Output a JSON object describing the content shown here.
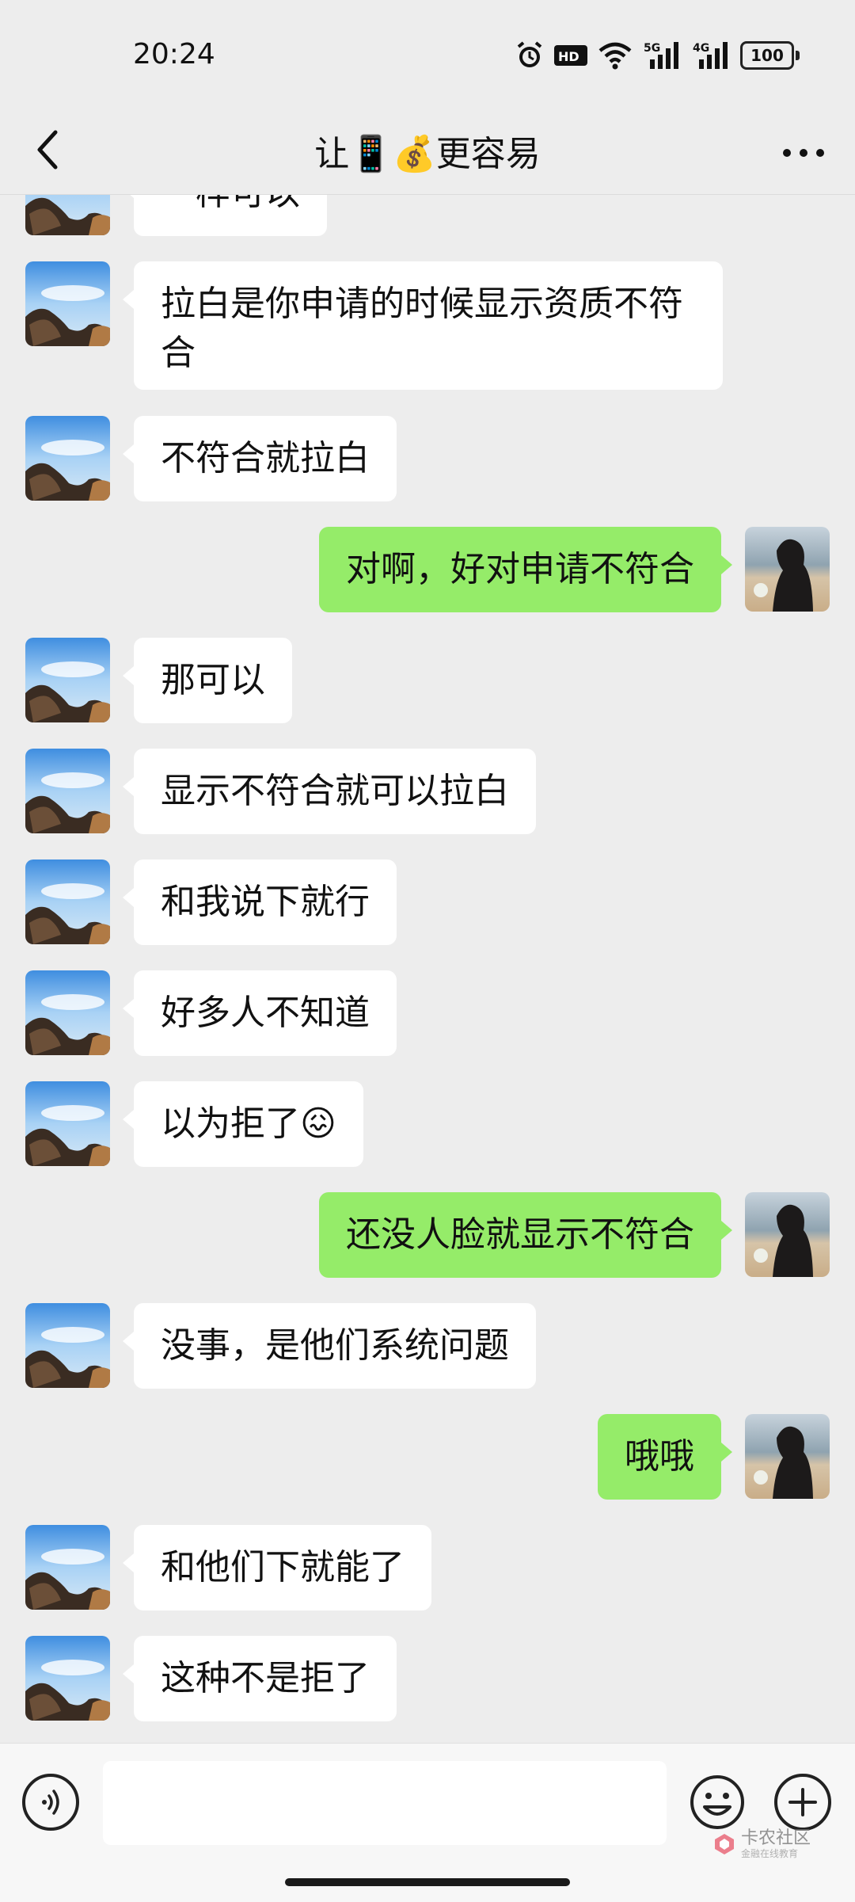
{
  "status_bar": {
    "time": "20:24",
    "network_1": "5G",
    "network_2": "4G",
    "battery": "100",
    "icons": [
      "alarm-icon",
      "hd-icon",
      "wifi-icon",
      "signal-5g-icon",
      "signal-4g-icon",
      "battery-icon"
    ]
  },
  "header": {
    "title": "让📱💰更容易",
    "back_icon": "chevron-left-icon",
    "more_icon": "more-dots-icon"
  },
  "messages": [
    {
      "side": "left",
      "text": "一样可以"
    },
    {
      "side": "left",
      "text": "拉白是你申请的时候显示资质不符合"
    },
    {
      "side": "left",
      "text": "不符合就拉白"
    },
    {
      "side": "right",
      "text": "对啊，好对申请不符合"
    },
    {
      "side": "left",
      "text": "那可以"
    },
    {
      "side": "left",
      "text": "显示不符合就可以拉白"
    },
    {
      "side": "left",
      "text": "和我说下就行"
    },
    {
      "side": "left",
      "text": "好多人不知道"
    },
    {
      "side": "left",
      "text": "以为拒了😖"
    },
    {
      "side": "right",
      "text": "还没人脸就显示不符合"
    },
    {
      "side": "left",
      "text": "没事，是他们系统问题"
    },
    {
      "side": "right",
      "text": "哦哦"
    },
    {
      "side": "left",
      "text": "和他们下就能了"
    },
    {
      "side": "left",
      "text": "这种不是拒了"
    }
  ],
  "input_bar": {
    "placeholder": "",
    "voice_icon": "voice-icon",
    "emoji_icon": "emoji-icon",
    "plus_icon": "plus-icon"
  },
  "watermark": {
    "title": "卡农社区",
    "subtitle": "金融在线教育"
  },
  "colors": {
    "background": "#ededed",
    "incoming_bubble": "#ffffff",
    "outgoing_bubble": "#95ec69"
  }
}
